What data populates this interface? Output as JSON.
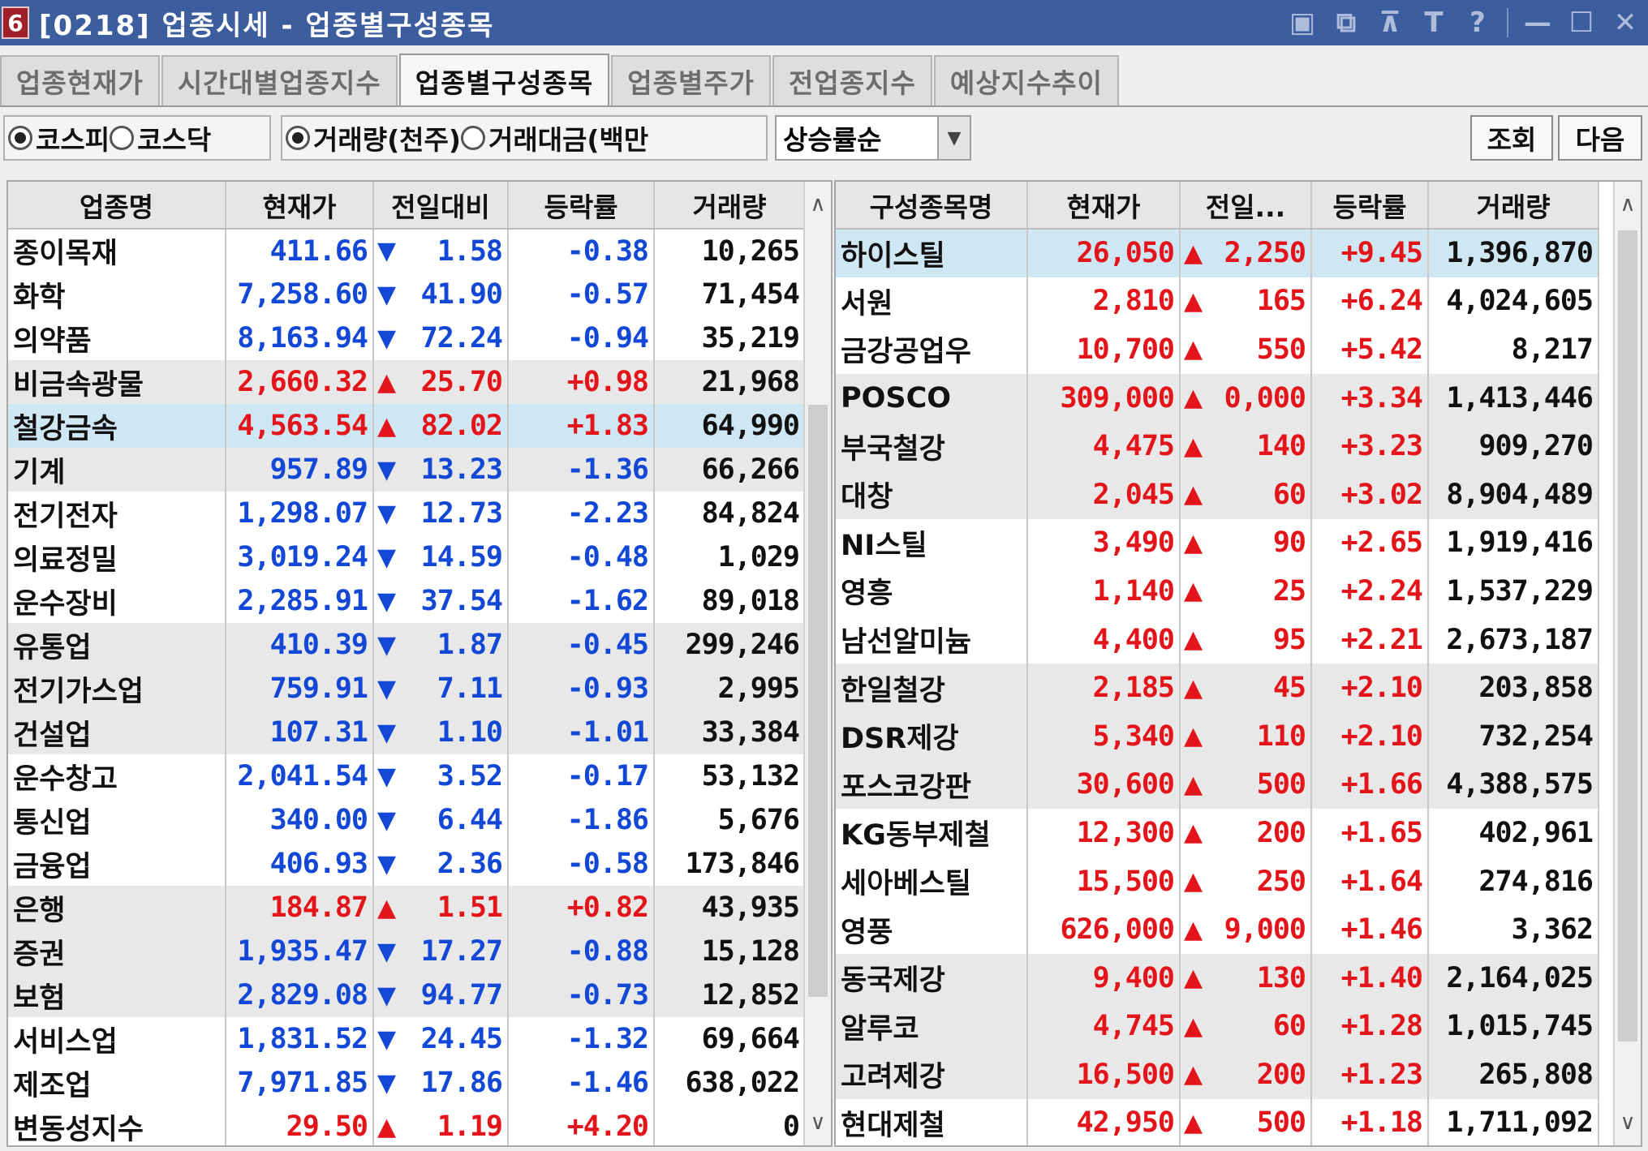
{
  "window": {
    "num": "6",
    "title": "[0218] 업종시세 - 업종별구성종목",
    "icons": [
      "layout-icon",
      "restore-windows-icon",
      "pin-icon",
      "text-icon",
      "help-icon",
      "minimize-icon",
      "maximize-icon",
      "close-icon"
    ],
    "icon_glyphs": [
      "▣",
      "⧉",
      "⊼",
      "T",
      "?",
      "—",
      "☐",
      "✕"
    ]
  },
  "tabs": [
    {
      "label": "업종현재가",
      "active": false
    },
    {
      "label": "시간대별업종지수",
      "active": false
    },
    {
      "label": "업종별구성종목",
      "active": true
    },
    {
      "label": "업종별주가",
      "active": false
    },
    {
      "label": "전업종지수",
      "active": false
    },
    {
      "label": "예상지수추이",
      "active": false
    }
  ],
  "toolbar": {
    "market": [
      {
        "label": "코스피",
        "checked": true
      },
      {
        "label": "코스닥",
        "checked": false
      }
    ],
    "basis": [
      {
        "label": "거래량(천주)",
        "checked": true
      },
      {
        "label": "거래대금(백만",
        "checked": false
      }
    ],
    "sort_value": "상승률순",
    "query_btn": "조회",
    "next_btn": "다음"
  },
  "left_grid": {
    "headers": [
      "업종명",
      "현재가",
      "전일대비",
      "등락률",
      "거래량"
    ],
    "rows": [
      {
        "name": "종이목재",
        "price": "411.66",
        "dir": "down",
        "chg": "1.58",
        "rate": "-0.38",
        "vol": "10,265",
        "style": ""
      },
      {
        "name": "화학",
        "price": "7,258.60",
        "dir": "down",
        "chg": "41.90",
        "rate": "-0.57",
        "vol": "71,454",
        "style": ""
      },
      {
        "name": "의약품",
        "price": "8,163.94",
        "dir": "down",
        "chg": "72.24",
        "rate": "-0.94",
        "vol": "35,219",
        "style": ""
      },
      {
        "name": "비금속광물",
        "price": "2,660.32",
        "dir": "up",
        "chg": "25.70",
        "rate": "+0.98",
        "vol": "21,968",
        "style": "shade"
      },
      {
        "name": "철강금속",
        "price": "4,563.54",
        "dir": "up",
        "chg": "82.02",
        "rate": "+1.83",
        "vol": "64,990",
        "style": "sel"
      },
      {
        "name": "기계",
        "price": "957.89",
        "dir": "down",
        "chg": "13.23",
        "rate": "-1.36",
        "vol": "66,266",
        "style": "shade"
      },
      {
        "name": "전기전자",
        "price": "1,298.07",
        "dir": "down",
        "chg": "12.73",
        "rate": "-2.23",
        "vol": "84,824",
        "style": ""
      },
      {
        "name": "의료정밀",
        "price": "3,019.24",
        "dir": "down",
        "chg": "14.59",
        "rate": "-0.48",
        "vol": "1,029",
        "style": ""
      },
      {
        "name": "운수장비",
        "price": "2,285.91",
        "dir": "down",
        "chg": "37.54",
        "rate": "-1.62",
        "vol": "89,018",
        "style": ""
      },
      {
        "name": "유통업",
        "price": "410.39",
        "dir": "down",
        "chg": "1.87",
        "rate": "-0.45",
        "vol": "299,246",
        "style": "shade"
      },
      {
        "name": "전기가스업",
        "price": "759.91",
        "dir": "down",
        "chg": "7.11",
        "rate": "-0.93",
        "vol": "2,995",
        "style": "shade"
      },
      {
        "name": "건설업",
        "price": "107.31",
        "dir": "down",
        "chg": "1.10",
        "rate": "-1.01",
        "vol": "33,384",
        "style": "shade"
      },
      {
        "name": "운수창고",
        "price": "2,041.54",
        "dir": "down",
        "chg": "3.52",
        "rate": "-0.17",
        "vol": "53,132",
        "style": ""
      },
      {
        "name": "통신업",
        "price": "340.00",
        "dir": "down",
        "chg": "6.44",
        "rate": "-1.86",
        "vol": "5,676",
        "style": ""
      },
      {
        "name": "금융업",
        "price": "406.93",
        "dir": "down",
        "chg": "2.36",
        "rate": "-0.58",
        "vol": "173,846",
        "style": ""
      },
      {
        "name": "은행",
        "price": "184.87",
        "dir": "up",
        "chg": "1.51",
        "rate": "+0.82",
        "vol": "43,935",
        "style": "shade"
      },
      {
        "name": "증권",
        "price": "1,935.47",
        "dir": "down",
        "chg": "17.27",
        "rate": "-0.88",
        "vol": "15,128",
        "style": "shade"
      },
      {
        "name": "보험",
        "price": "2,829.08",
        "dir": "down",
        "chg": "94.77",
        "rate": "-0.73",
        "vol": "12,852",
        "style": "shade"
      },
      {
        "name": "서비스업",
        "price": "1,831.52",
        "dir": "down",
        "chg": "24.45",
        "rate": "-1.32",
        "vol": "69,664",
        "style": ""
      },
      {
        "name": "제조업",
        "price": "7,971.85",
        "dir": "down",
        "chg": "17.86",
        "rate": "-1.46",
        "vol": "638,022",
        "style": ""
      },
      {
        "name": "변동성지수",
        "price": "29.50",
        "dir": "up",
        "chg": "1.19",
        "rate": "+4.20",
        "vol": "0",
        "style": ""
      }
    ]
  },
  "right_grid": {
    "headers": [
      "구성종목명",
      "현재가",
      "전일...",
      "등락률",
      "거래량"
    ],
    "rows": [
      {
        "name": "하이스틸",
        "price": "26,050",
        "dir": "up",
        "chg": "2,250",
        "rate": "+9.45",
        "vol": "1,396,870",
        "style": "sel"
      },
      {
        "name": "서원",
        "price": "2,810",
        "dir": "up",
        "chg": "165",
        "rate": "+6.24",
        "vol": "4,024,605",
        "style": ""
      },
      {
        "name": "금강공업우",
        "price": "10,700",
        "dir": "up",
        "chg": "550",
        "rate": "+5.42",
        "vol": "8,217",
        "style": ""
      },
      {
        "name": "POSCO",
        "price": "309,000",
        "dir": "up",
        "chg": "0,000",
        "rate": "+3.34",
        "vol": "1,413,446",
        "style": "shade"
      },
      {
        "name": "부국철강",
        "price": "4,475",
        "dir": "up",
        "chg": "140",
        "rate": "+3.23",
        "vol": "909,270",
        "style": "shade"
      },
      {
        "name": "대창",
        "price": "2,045",
        "dir": "up",
        "chg": "60",
        "rate": "+3.02",
        "vol": "8,904,489",
        "style": "shade"
      },
      {
        "name": "NI스틸",
        "price": "3,490",
        "dir": "up",
        "chg": "90",
        "rate": "+2.65",
        "vol": "1,919,416",
        "style": ""
      },
      {
        "name": "영흥",
        "price": "1,140",
        "dir": "up",
        "chg": "25",
        "rate": "+2.24",
        "vol": "1,537,229",
        "style": ""
      },
      {
        "name": "남선알미늄",
        "price": "4,400",
        "dir": "up",
        "chg": "95",
        "rate": "+2.21",
        "vol": "2,673,187",
        "style": ""
      },
      {
        "name": "한일철강",
        "price": "2,185",
        "dir": "up",
        "chg": "45",
        "rate": "+2.10",
        "vol": "203,858",
        "style": "shade"
      },
      {
        "name": "DSR제강",
        "price": "5,340",
        "dir": "up",
        "chg": "110",
        "rate": "+2.10",
        "vol": "732,254",
        "style": "shade"
      },
      {
        "name": "포스코강판",
        "price": "30,600",
        "dir": "up",
        "chg": "500",
        "rate": "+1.66",
        "vol": "4,388,575",
        "style": "shade"
      },
      {
        "name": "KG동부제철",
        "price": "12,300",
        "dir": "up",
        "chg": "200",
        "rate": "+1.65",
        "vol": "402,961",
        "style": ""
      },
      {
        "name": "세아베스틸",
        "price": "15,500",
        "dir": "up",
        "chg": "250",
        "rate": "+1.64",
        "vol": "274,816",
        "style": ""
      },
      {
        "name": "영풍",
        "price": "626,000",
        "dir": "up",
        "chg": "9,000",
        "rate": "+1.46",
        "vol": "3,362",
        "style": ""
      },
      {
        "name": "동국제강",
        "price": "9,400",
        "dir": "up",
        "chg": "130",
        "rate": "+1.40",
        "vol": "2,164,025",
        "style": "shade"
      },
      {
        "name": "알루코",
        "price": "4,745",
        "dir": "up",
        "chg": "60",
        "rate": "+1.28",
        "vol": "1,015,745",
        "style": "shade"
      },
      {
        "name": "고려제강",
        "price": "16,500",
        "dir": "up",
        "chg": "200",
        "rate": "+1.23",
        "vol": "265,808",
        "style": "shade"
      },
      {
        "name": "현대제철",
        "price": "42,950",
        "dir": "up",
        "chg": "500",
        "rate": "+1.18",
        "vol": "1,711,092",
        "style": ""
      }
    ]
  },
  "scroll": {
    "up_glyph": "∧",
    "down_glyph": "∨"
  },
  "colors": {
    "up": "#e3141a",
    "down": "#1348d6",
    "titlebar": "#3c5d9e",
    "selected_row": "#cfe6f3",
    "shaded_row": "#e8e8e8"
  }
}
